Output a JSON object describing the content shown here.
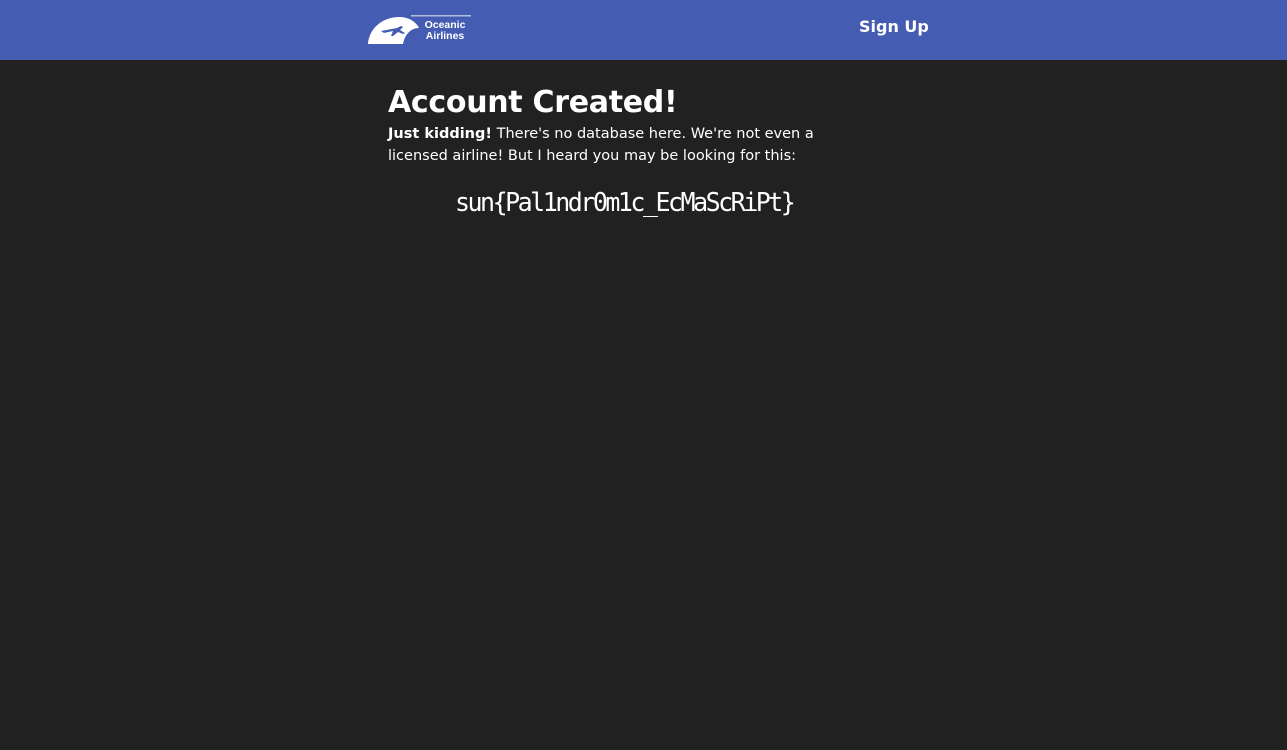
{
  "navbar": {
    "background": "#455cb3",
    "logo": {
      "line1": "Oceanic",
      "line2": "Airlines",
      "icon": "plane-icon"
    },
    "sign_up_label": "Sign Up"
  },
  "main": {
    "title": "Account Created!",
    "message_strong": "Just kidding!",
    "message_rest": "There's no database here. We're not even a licensed airline! But I heard you may be looking for this:",
    "flag": "sun{Pal1ndr0m1c_EcMaScRiPt}"
  },
  "colors": {
    "background": "#212121",
    "text": "#ffffff",
    "accent": "#455cb3"
  }
}
